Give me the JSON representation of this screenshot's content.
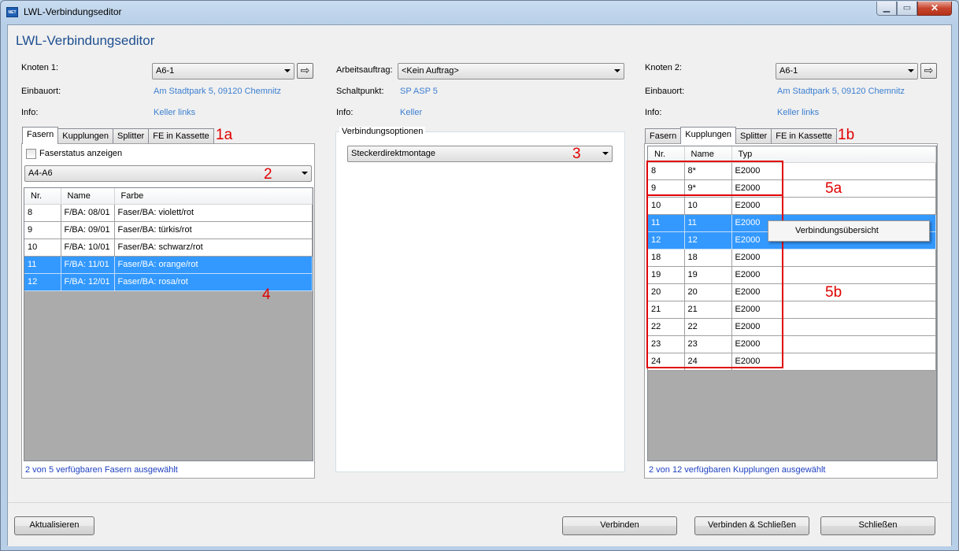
{
  "window": {
    "title": "LWL-Verbindungseditor",
    "app_icon_text": "NET"
  },
  "page_title": "LWL-Verbindungseditor",
  "left": {
    "knoten_label": "Knoten 1:",
    "knoten_value": "A6-1",
    "einbauort_label": "Einbauort:",
    "einbauort_value": "Am Stadtpark 5, 09120 Chemnitz",
    "info_label": "Info:",
    "info_value": "Keller links",
    "tabs": [
      "Fasern",
      "Kupplungen",
      "Splitter",
      "FE in Kassette"
    ],
    "faserstatus_label": "Faserstatus anzeigen",
    "cable_value": "A4-A6",
    "columns": [
      "Nr.",
      "Name",
      "Farbe"
    ],
    "rows": [
      {
        "nr": "8",
        "name": "F/BA: 08/01",
        "farbe": "Faser/BA: violett/rot",
        "selected": false
      },
      {
        "nr": "9",
        "name": "F/BA: 09/01",
        "farbe": "Faser/BA: türkis/rot",
        "selected": false
      },
      {
        "nr": "10",
        "name": "F/BA: 10/01",
        "farbe": "Faser/BA: schwarz/rot",
        "selected": false
      },
      {
        "nr": "11",
        "name": "F/BA: 11/01",
        "farbe": "Faser/BA: orange/rot",
        "selected": true
      },
      {
        "nr": "12",
        "name": "F/BA: 12/01",
        "farbe": "Faser/BA: rosa/rot",
        "selected": true
      }
    ],
    "status": "2 von 5 verfügbaren Fasern ausgewählt"
  },
  "middle": {
    "auftrag_label": "Arbeitsauftrag:",
    "auftrag_value": "<Kein Auftrag>",
    "schaltpunkt_label": "Schaltpunkt:",
    "schaltpunkt_value": "SP ASP 5",
    "info_label": "Info:",
    "info_value": "Keller",
    "group_title": "Verbindungsoptionen",
    "option_value": "Steckerdirektmontage"
  },
  "right": {
    "knoten_label": "Knoten 2:",
    "knoten_value": "A6-1",
    "einbauort_label": "Einbauort:",
    "einbauort_value": "Am Stadtpark 5, 09120 Chemnitz",
    "info_label": "Info:",
    "info_value": "Keller links",
    "tabs": [
      "Fasern",
      "Kupplungen",
      "Splitter",
      "FE in Kassette"
    ],
    "columns": [
      "Nr.",
      "Name",
      "Typ"
    ],
    "rows": [
      {
        "nr": "8",
        "name": "8*",
        "typ": "E2000",
        "selected": false
      },
      {
        "nr": "9",
        "name": "9*",
        "typ": "E2000",
        "selected": false
      },
      {
        "nr": "10",
        "name": "10",
        "typ": "E2000",
        "selected": false
      },
      {
        "nr": "11",
        "name": "11",
        "typ": "E2000",
        "selected": true
      },
      {
        "nr": "12",
        "name": "12",
        "typ": "E2000",
        "selected": true
      },
      {
        "nr": "18",
        "name": "18",
        "typ": "E2000",
        "selected": false
      },
      {
        "nr": "19",
        "name": "19",
        "typ": "E2000",
        "selected": false
      },
      {
        "nr": "20",
        "name": "20",
        "typ": "E2000",
        "selected": false
      },
      {
        "nr": "21",
        "name": "21",
        "typ": "E2000",
        "selected": false
      },
      {
        "nr": "22",
        "name": "22",
        "typ": "E2000",
        "selected": false
      },
      {
        "nr": "23",
        "name": "23",
        "typ": "E2000",
        "selected": false
      },
      {
        "nr": "24",
        "name": "24",
        "typ": "E2000",
        "selected": false
      }
    ],
    "context_menu_item": "Verbindungsübersicht",
    "status": "2 von 12 verfügbaren Kupplungen ausgewählt"
  },
  "annotations": {
    "a1a": "1a",
    "a1b": "1b",
    "a2": "2",
    "a3": "3",
    "a4": "4",
    "a5a": "5a",
    "a5b": "5b"
  },
  "buttons": {
    "aktualisieren": "Aktualisieren",
    "verbinden": "Verbinden",
    "verbinden_schliessen": "Verbinden & Schließen",
    "schliessen": "Schließen"
  },
  "icons": {
    "nav_arrow": "arrow-right-icon",
    "dropdown": "chevron-down-icon"
  },
  "colors": {
    "selection": "#3399ff",
    "link": "#3c7fd0",
    "annotation": "#e00000",
    "title": "#1e4f91"
  }
}
